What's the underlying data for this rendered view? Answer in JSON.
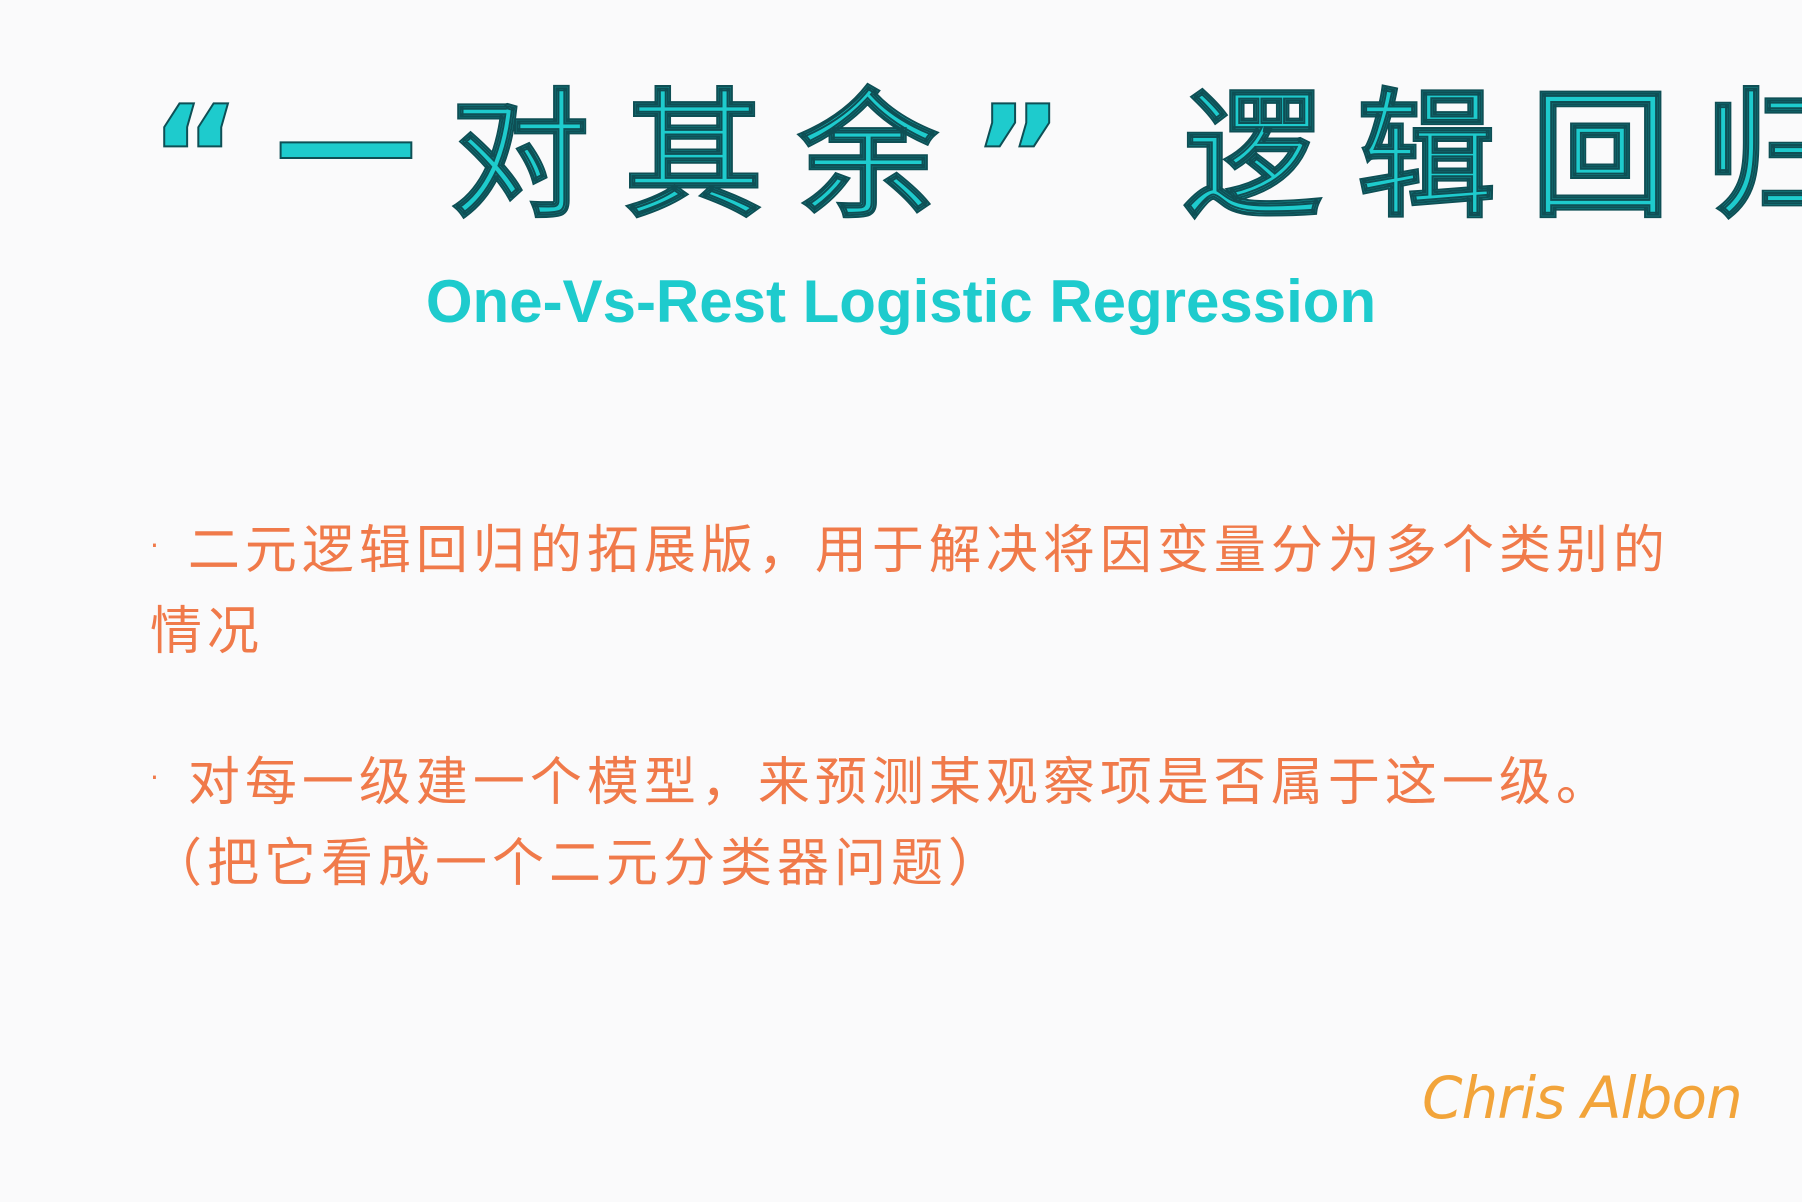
{
  "title": {
    "chinese": "“一对其余” 逻辑回归",
    "english": "One-Vs-Rest Logistic Regression"
  },
  "bullets": [
    {
      "marker": "·",
      "text": "二元逻辑回归的拓展版，用于解决将因变量分为多个类别的情况"
    },
    {
      "marker": "·",
      "text": "对每一级建一个模型，来预测某观察项是否属于这一级。（把它看成一个二元分类器问题）"
    }
  ],
  "signature": "Chris Albon",
  "colors": {
    "background": "#fafafb",
    "title": "#1ecbcd",
    "title_outline": "#0e4f55",
    "body_text": "#f07a4a",
    "signature": "#f2a43a"
  }
}
